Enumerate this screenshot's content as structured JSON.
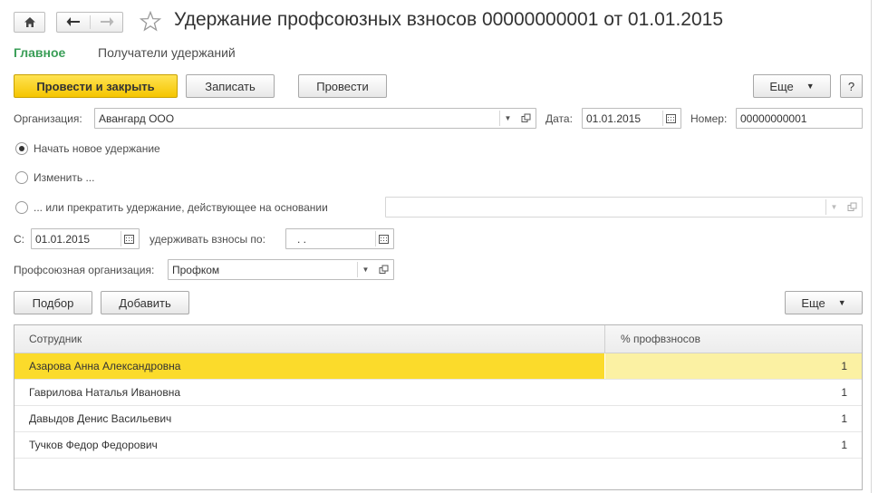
{
  "window": {
    "title": "Удержание профсоюзных взносов 00000000001 от 01.01.2015",
    "icons": {
      "home": "home-icon",
      "back": "arrow-left-icon",
      "forward": "arrow-right-icon",
      "favorite": "star-icon"
    }
  },
  "tabs": [
    {
      "label": "Главное",
      "active": true
    },
    {
      "label": "Получатели удержаний",
      "active": false
    }
  ],
  "toolbar": {
    "post_close_label": "Провести и закрыть",
    "save_label": "Записать",
    "post_label": "Провести",
    "more_label": "Еще",
    "help_label": "?"
  },
  "header": {
    "org_label": "Организация:",
    "org_value": "Авангард ООО",
    "date_label": "Дата:",
    "date_value": "01.01.2015",
    "number_label": "Номер:",
    "number_value": "00000000001"
  },
  "mode": {
    "options": [
      {
        "label": "Начать новое удержание",
        "selected": true
      },
      {
        "label": "Изменить ...",
        "selected": false
      },
      {
        "label": "... или прекратить удержание, действующее на основании",
        "selected": false
      }
    ],
    "basis_value": ""
  },
  "period": {
    "from_label": "С:",
    "from_value": "01.01.2015",
    "to_label": "удерживать взносы по:",
    "to_value": " .  ."
  },
  "union": {
    "label": "Профсоюзная организация:",
    "value": "Профком"
  },
  "table_toolbar": {
    "pick_label": "Подбор",
    "add_label": "Добавить",
    "more_label": "Еще"
  },
  "table": {
    "columns": [
      "Сотрудник",
      "% профвзносов"
    ],
    "rows": [
      {
        "employee": "Азарова Анна Александровна",
        "percent": "1",
        "selected": true
      },
      {
        "employee": "Гаврилова Наталья Ивановна",
        "percent": "1",
        "selected": false
      },
      {
        "employee": "Давыдов Денис Васильевич",
        "percent": "1",
        "selected": false
      },
      {
        "employee": "Тучков Федор Федорович",
        "percent": "1",
        "selected": false
      }
    ]
  },
  "colors": {
    "accent_yellow": "#fbdb2b",
    "tab_green": "#3a9e57"
  }
}
